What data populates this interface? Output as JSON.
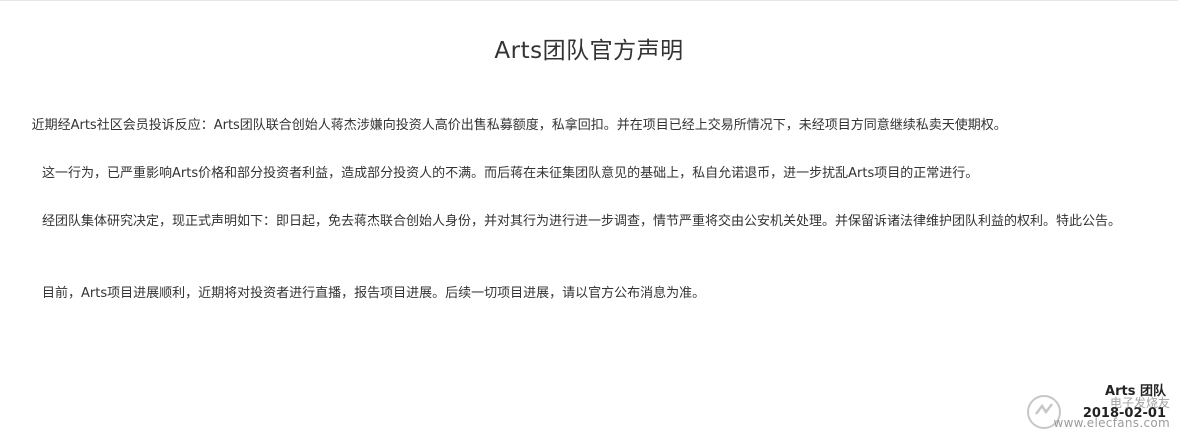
{
  "document": {
    "title": "Arts团队官方声明",
    "paragraphs": [
      "近期经Arts社区会员投诉反应：Arts团队联合创始人蒋杰涉嫌向投资人高价出售私募额度，私拿回扣。并在项目已经上交易所情况下，未经项目方同意继续私卖天使期权。",
      "这一行为，已严重影响Arts价格和部分投资者利益，造成部分投资人的不满。而后蒋在未征集团队意见的基础上，私自允诺退币，进一步扰乱Arts项目的正常进行。",
      "经团队集体研究决定，现正式声明如下：即日起，免去蒋杰联合创始人身份，并对其行为进行进一步调查，情节严重将交由公安机关处理。并保留诉诸法律维护团队利益的权利。特此公告。",
      "目前，Arts项目进展顺利，近期将对投资者进行直播，报告项目进展。后续一切项目进展，请以官方公布消息为准。"
    ],
    "signature": {
      "team": "Arts 团队",
      "date": "2018-02-01"
    }
  },
  "watermark": {
    "text": "电子发烧友",
    "url_text": "www.elecfans.com"
  }
}
